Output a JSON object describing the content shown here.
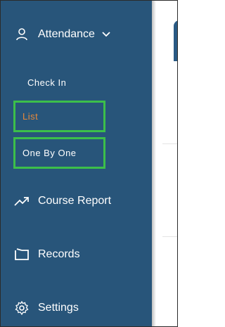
{
  "sidebar": {
    "attendance": {
      "label": "Attendance",
      "icon": "user-icon",
      "expanded": true
    },
    "submenu": [
      {
        "label": "Check In",
        "highlighted": false
      },
      {
        "label": "List",
        "highlighted": true,
        "color": "#e8893a"
      },
      {
        "label": "One By One",
        "highlighted": true,
        "color": "#ffffff"
      }
    ],
    "course_report": {
      "label": "Course Report",
      "icon": "trend-up-icon"
    },
    "records": {
      "label": "Records",
      "icon": "folder-icon"
    },
    "settings": {
      "label": "Settings",
      "icon": "gear-icon"
    }
  },
  "colors": {
    "sidebar_bg": "#28557a",
    "highlight_border": "#3cbf4a",
    "active_text": "#e8893a"
  }
}
